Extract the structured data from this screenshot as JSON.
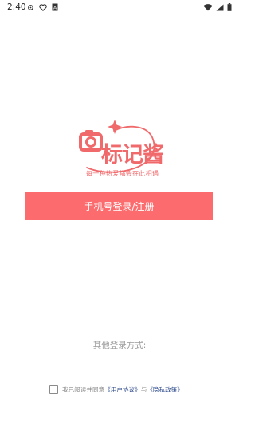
{
  "status_bar": {
    "time": "2:40"
  },
  "logo": {
    "name": "标记酱",
    "tagline": "每一种热爱都会在此相遇"
  },
  "login_button": {
    "label": "手机号登录/注册"
  },
  "other_login": {
    "label": "其他登录方式:"
  },
  "agreement": {
    "prefix": "我已阅读并同意",
    "user_agreement": "《用户协议》",
    "and": "与",
    "privacy_policy": "《隐私政策》",
    "checked": false
  },
  "colors": {
    "brand": "#fc6c6e",
    "link": "#2d4a8c"
  }
}
